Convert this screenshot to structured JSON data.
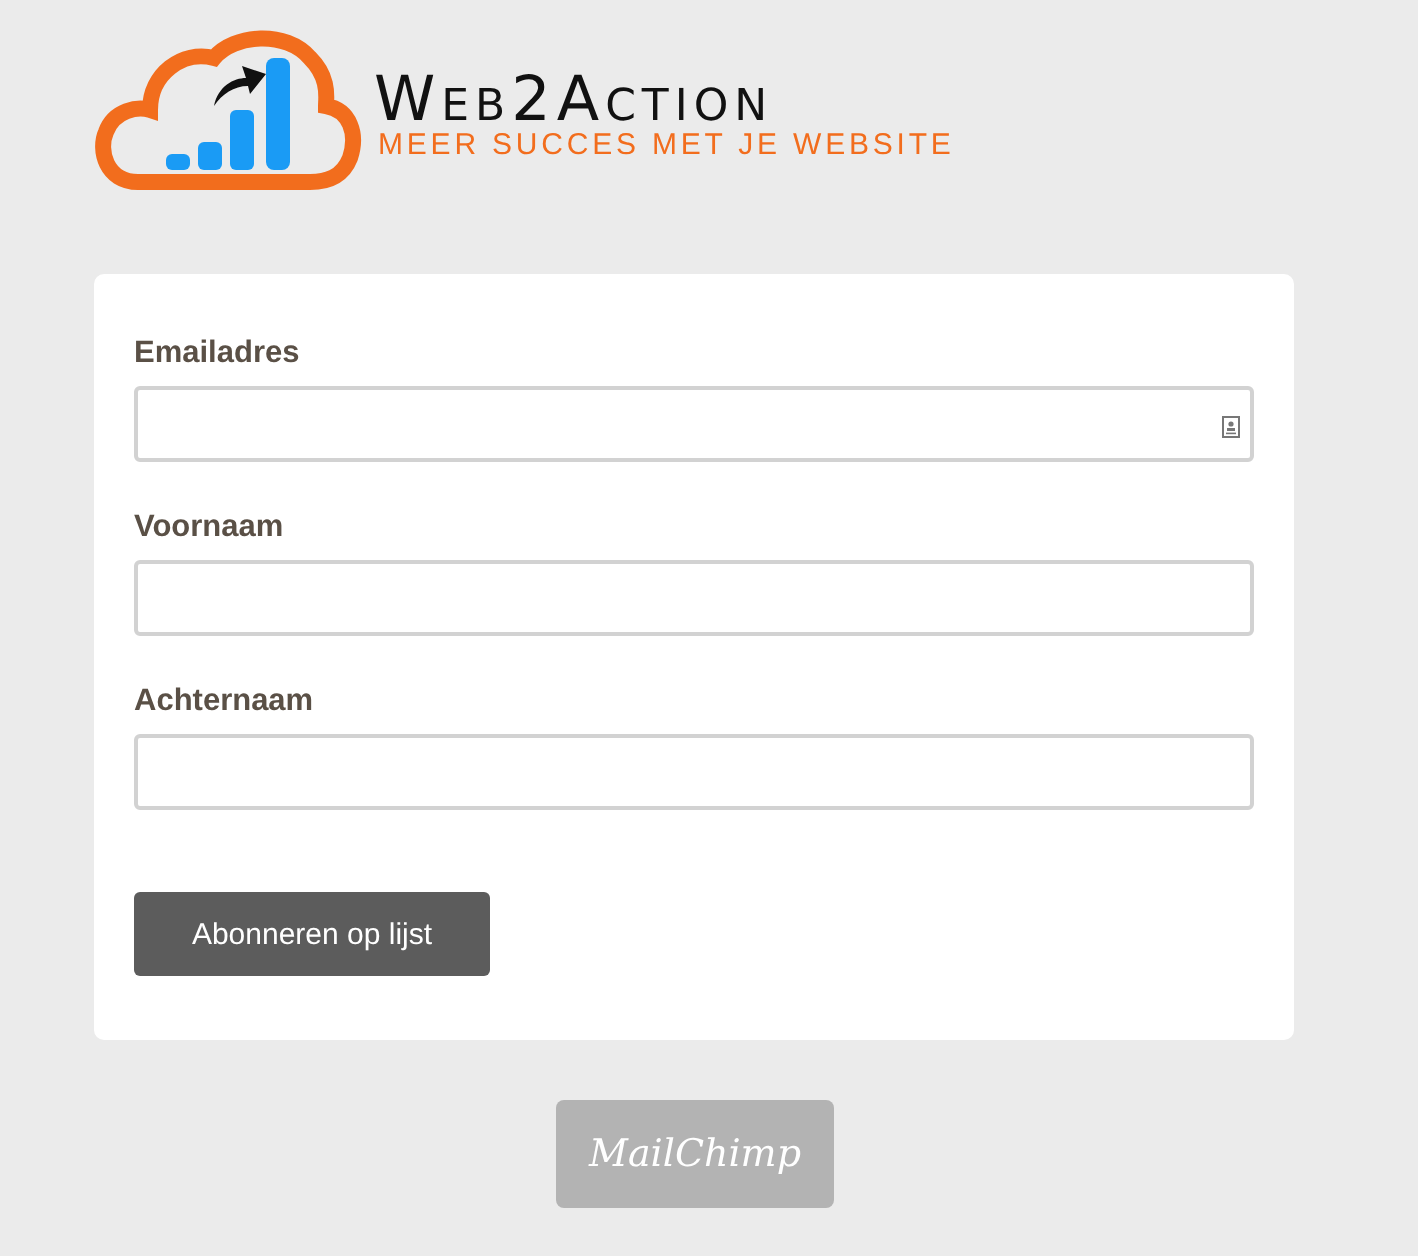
{
  "logo": {
    "name": "Web2Action",
    "tagline": "MEER SUCCES MET JE WEBSITE"
  },
  "form": {
    "fields": [
      {
        "label": "Emailadres",
        "autofill_icon": true
      },
      {
        "label": "Voornaam",
        "autofill_icon": false
      },
      {
        "label": "Achternaam",
        "autofill_icon": false
      }
    ],
    "submit": "Abonneren op lijst"
  },
  "badge": "MailChimp"
}
